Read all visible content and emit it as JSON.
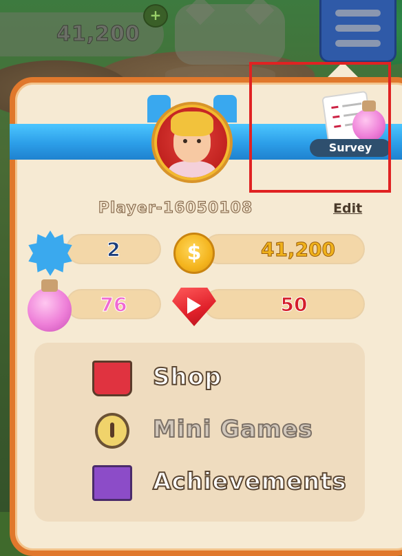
{
  "hud": {
    "coins": "41,200",
    "plus_glyph": "+",
    "menu_icon": "hamburger-menu-icon"
  },
  "profile": {
    "player_name": "Player-16050108",
    "edit_label": "Edit",
    "survey_label": "Survey"
  },
  "stats": {
    "level": "2",
    "coins": "41,200",
    "coin_glyph": "$",
    "potions": "76",
    "rubies": "50"
  },
  "colors": {
    "level": "#1b3d7a",
    "coins": "#e9a514",
    "potions": "#e24fc4",
    "rubies": "#d41d2a",
    "highlight_box": "#e02222",
    "panel_border": "#e0782c"
  },
  "menu": {
    "items": [
      {
        "label": "Shop",
        "icon": "shop-basket-icon"
      },
      {
        "label": "Mini Games",
        "icon": "stopwatch-icon"
      },
      {
        "label": "Achievements",
        "icon": "book-icon"
      }
    ]
  }
}
